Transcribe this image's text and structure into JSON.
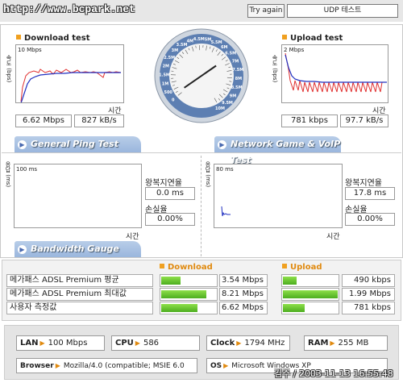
{
  "header": {
    "site_url": "http://www.bcpark.net",
    "try_again_label": "Try again",
    "test_mode_label": "UDP 테스트"
  },
  "download": {
    "title": "Download test",
    "scale_label": "10 Mbps",
    "y_axis_label": "속도 (bps)",
    "time_label": "시간",
    "mbps_value": "6.62 Mbps",
    "kbs_value": "827 kB/s"
  },
  "upload": {
    "title": "Upload test",
    "scale_label": "2 Mbps",
    "y_axis_label": "속도 (bps)",
    "time_label": "시간",
    "kbps_value": "781 kbps",
    "kbs_value": "97.7 kB/s"
  },
  "speed_dial": {
    "tick_labels": [
      "0",
      "500",
      "1M",
      "1.5M",
      "2M",
      "2.5M",
      "3M",
      "3.5M",
      "4M",
      "4.5M",
      "5M",
      "5.5M",
      "6M",
      "6.5M",
      "7M",
      "7.5M",
      "8M",
      "8.5M",
      "9M",
      "9.5M",
      "10M"
    ],
    "needle_value_mbps": 6.62
  },
  "ping": {
    "banner_label": "General Ping Test",
    "scale_label": "100 ms",
    "y_axis_label": "응답 (ms)",
    "time_label": "시간",
    "latency_label": "왕복지연율",
    "latency_value": "0.0 ms",
    "loss_label": "손실율",
    "loss_value": "0.00%"
  },
  "game": {
    "banner_label": "Network Game & VoIP Test",
    "scale_label": "80 ms",
    "y_axis_label": "응답 (ms)",
    "time_label": "시간",
    "latency_label": "왕복지연율",
    "latency_value": "17.8 ms",
    "loss_label": "손실율",
    "loss_value": "0.00%"
  },
  "bandwidth": {
    "banner_label": "Bandwidth Gauge",
    "download_header": "Download",
    "upload_header": "Upload",
    "rows": [
      {
        "label": "메가패스 ADSL Premium 평균",
        "download": "3.54 Mbps",
        "download_fraction": 0.354,
        "upload": "490 kbps",
        "upload_fraction": 0.245
      },
      {
        "label": "메가패스 ADSL Premium 최대값",
        "download": "8.21 Mbps",
        "download_fraction": 0.821,
        "upload": "1.99 Mbps",
        "upload_fraction": 0.995
      },
      {
        "label": "사용자 측정값",
        "download": "6.62 Mbps",
        "download_fraction": 0.662,
        "upload": "781 kbps",
        "upload_fraction": 0.39
      }
    ]
  },
  "system": {
    "lan_key": "LAN",
    "lan_value": "100 Mbps",
    "cpu_key": "CPU",
    "cpu_value": "586",
    "clock_key": "Clock",
    "clock_value": "1794 MHz",
    "ram_key": "RAM",
    "ram_value": "255 MB",
    "browser_key": "Browser",
    "browser_value": "Mozilla/4.0 (compatible; MSIE 6.0",
    "os_key": "OS",
    "os_value": "Microsoft Windows XP"
  },
  "watermark": "김주 / 2003-11-13 16:55:48",
  "colors": {
    "accent_orange": "#f0a020",
    "download_line_red": "#e03030",
    "download_line_blue": "#2030c0",
    "banner_blue": "#9ab6dd",
    "bar_green": "#4cae1f"
  }
}
